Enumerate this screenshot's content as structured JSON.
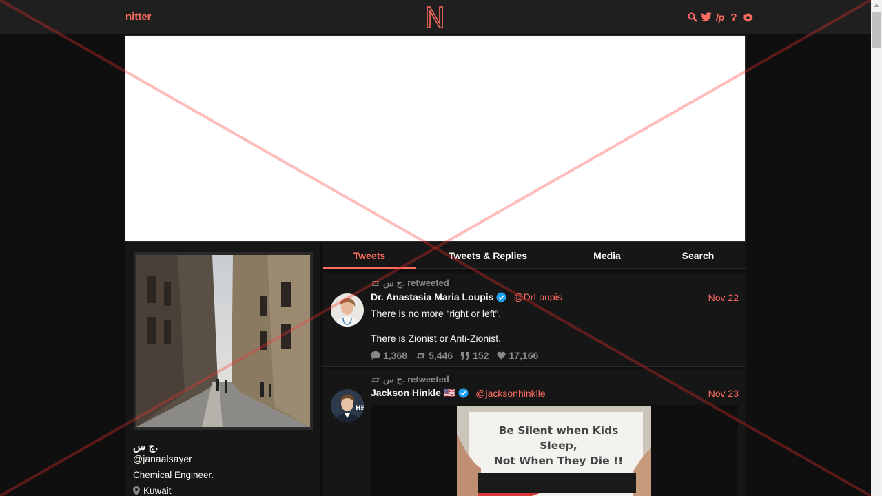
{
  "nav": {
    "site_name": "nitter",
    "logo": "N",
    "icons": [
      "search-icon",
      "twitter-icon",
      "rss-icon",
      "help-icon",
      "gear-icon"
    ],
    "rss_glyph": "lp",
    "help_glyph": "?"
  },
  "colors": {
    "accent": "#ff6c60",
    "background": "#0f0f0f",
    "panel": "#161616",
    "navbar": "#1f1f1f",
    "muted": "#888889",
    "verified": "#1da1f2"
  },
  "profile": {
    "fullname": "ج س.",
    "username": "@janaalsayer_",
    "bio": "Chemical Engineer.",
    "location": "Kuwait"
  },
  "tabs": [
    {
      "label": "Tweets",
      "active": true
    },
    {
      "label": "Tweets & Replies",
      "active": false
    },
    {
      "label": "Media",
      "active": false
    },
    {
      "label": "Search",
      "active": false
    }
  ],
  "tweets": [
    {
      "retweet_label": "ج س. retweeted",
      "fullname": "Dr. Anastasia Maria Loupis",
      "username": "@DrLoupis",
      "date": "Nov 22",
      "paragraphs": [
        "There is no more “right or left”.",
        "There is Zionist or Anti-Zionist."
      ],
      "stats": {
        "replies": "1,368",
        "retweets": "5,446",
        "quotes": "152",
        "likes": "17,166"
      }
    },
    {
      "retweet_label": "ج س. retweeted",
      "fullname": "Jackson Hinkle 🇺🇸",
      "username": "@jacksonhinklle",
      "date": "Nov 23",
      "media_text": [
        "Be Silent when Kids",
        "Sleep,",
        "Not When They Die !!"
      ]
    }
  ]
}
